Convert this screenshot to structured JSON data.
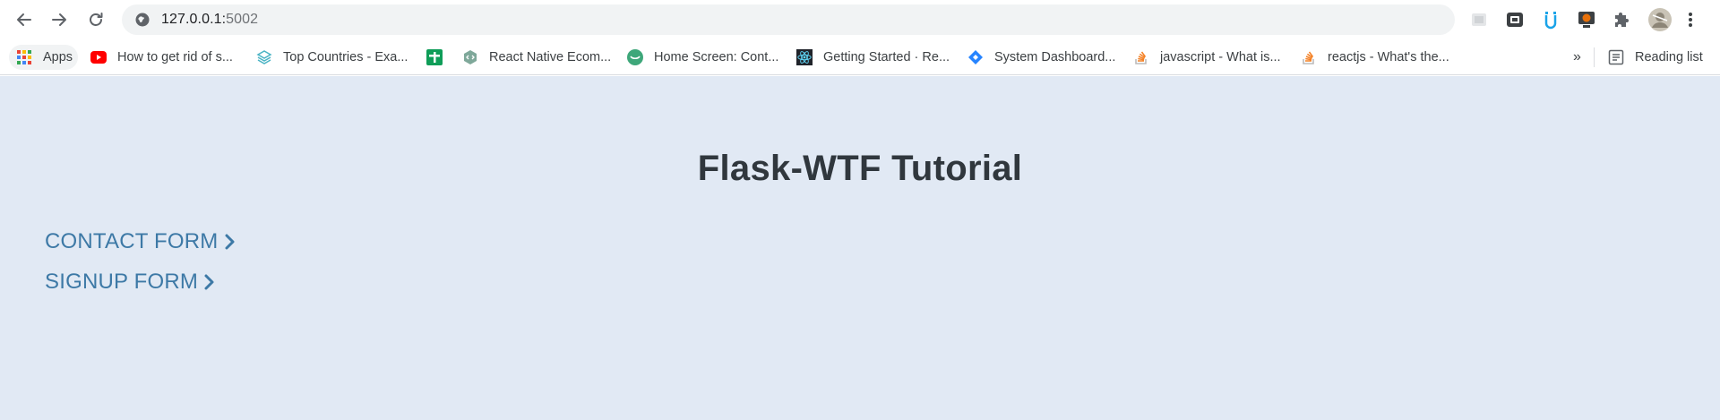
{
  "browser": {
    "url_host": "127.0.0.1:",
    "url_port": "5002",
    "extensions": [
      "extension-1-icon",
      "extension-2-icon",
      "extension-3-icon",
      "extension-4-icon",
      "puzzle-icon",
      "avatar",
      "more-vert-icon"
    ]
  },
  "bookmarks": {
    "items": [
      {
        "label": "Apps",
        "icon": "apps-grid-icon"
      },
      {
        "label": "How to get rid of s...",
        "icon": "youtube-icon"
      },
      {
        "label": "Top Countries - Exa...",
        "icon": "layers-icon"
      },
      {
        "label": "",
        "icon": "sheets-icon"
      },
      {
        "label": "React Native Ecom...",
        "icon": "code-hex-icon"
      },
      {
        "label": "Home Screen: Cont...",
        "icon": "green-circle-icon"
      },
      {
        "label": "Getting Started · Re...",
        "icon": "react-icon"
      },
      {
        "label": "System Dashboard...",
        "icon": "jira-icon"
      },
      {
        "label": "javascript - What is...",
        "icon": "stackoverflow-icon"
      },
      {
        "label": "reactjs - What's the...",
        "icon": "stackoverflow-icon"
      }
    ],
    "overflow": "»",
    "reading_list": "Reading list"
  },
  "page": {
    "title": "Flask-WTF Tutorial",
    "links": [
      {
        "label": "CONTACT FORM"
      },
      {
        "label": "SIGNUP FORM"
      }
    ]
  },
  "colors": {
    "page_bg": "#e1e9f4",
    "title": "#30373d",
    "link": "#3d79a6"
  }
}
